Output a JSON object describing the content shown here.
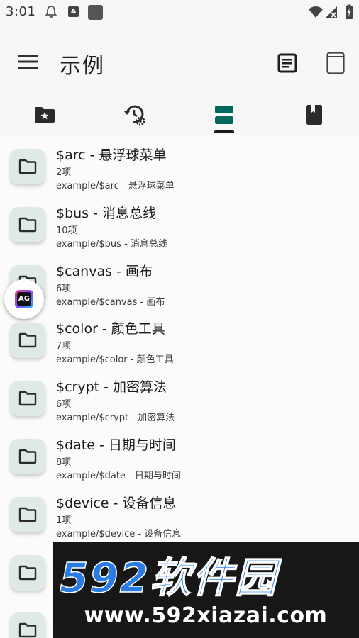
{
  "status_bar": {
    "time": "3:01",
    "icons": [
      "bell-icon",
      "text-a-icon",
      "app-square-icon",
      "wifi-icon",
      "signal-icon",
      "battery-icon"
    ]
  },
  "app_bar": {
    "title": "示例",
    "menu_icon": "menu-icon",
    "actions": [
      "document-icon",
      "window-icon"
    ]
  },
  "tabs": [
    {
      "icon": "folder-star-icon",
      "selected": false
    },
    {
      "icon": "history-settings-icon",
      "selected": false
    },
    {
      "icon": "storage-icon",
      "selected": true
    },
    {
      "icon": "book-icon",
      "selected": false
    }
  ],
  "list": {
    "items": [
      {
        "title": "$arc - 悬浮球菜单",
        "count": "2项",
        "path": "example/$arc - 悬浮球菜单"
      },
      {
        "title": "$bus - 消息总线",
        "count": "10项",
        "path": "example/$bus - 消息总线"
      },
      {
        "title": "$canvas - 画布",
        "count": "6项",
        "path": "example/$canvas - 画布"
      },
      {
        "title": "$color - 颜色工具",
        "count": "7项",
        "path": "example/$color - 颜色工具"
      },
      {
        "title": "$crypt - 加密算法",
        "count": "6项",
        "path": "example/$crypt - 加密算法"
      },
      {
        "title": "$date - 日期与时间",
        "count": "8项",
        "path": "example/$date - 日期与时间"
      },
      {
        "title": "$device - 设备信息",
        "count": "1项",
        "path": "example/$device - 设备信息"
      },
      {
        "title": "",
        "count": "",
        "path": ""
      },
      {
        "title": "",
        "count": "",
        "path": ""
      }
    ]
  },
  "floating_ball": {
    "label": "AG"
  },
  "watermark": {
    "brand": "592软件园",
    "url": "www.592xiazai.com",
    "colors": {
      "number": "#2a7be4",
      "text": "#ffffff",
      "background": "#171717"
    }
  },
  "colors": {
    "folder_bg": "#dfeae5",
    "selected_tab": "#00695c",
    "icon": "#2b2b2b"
  }
}
